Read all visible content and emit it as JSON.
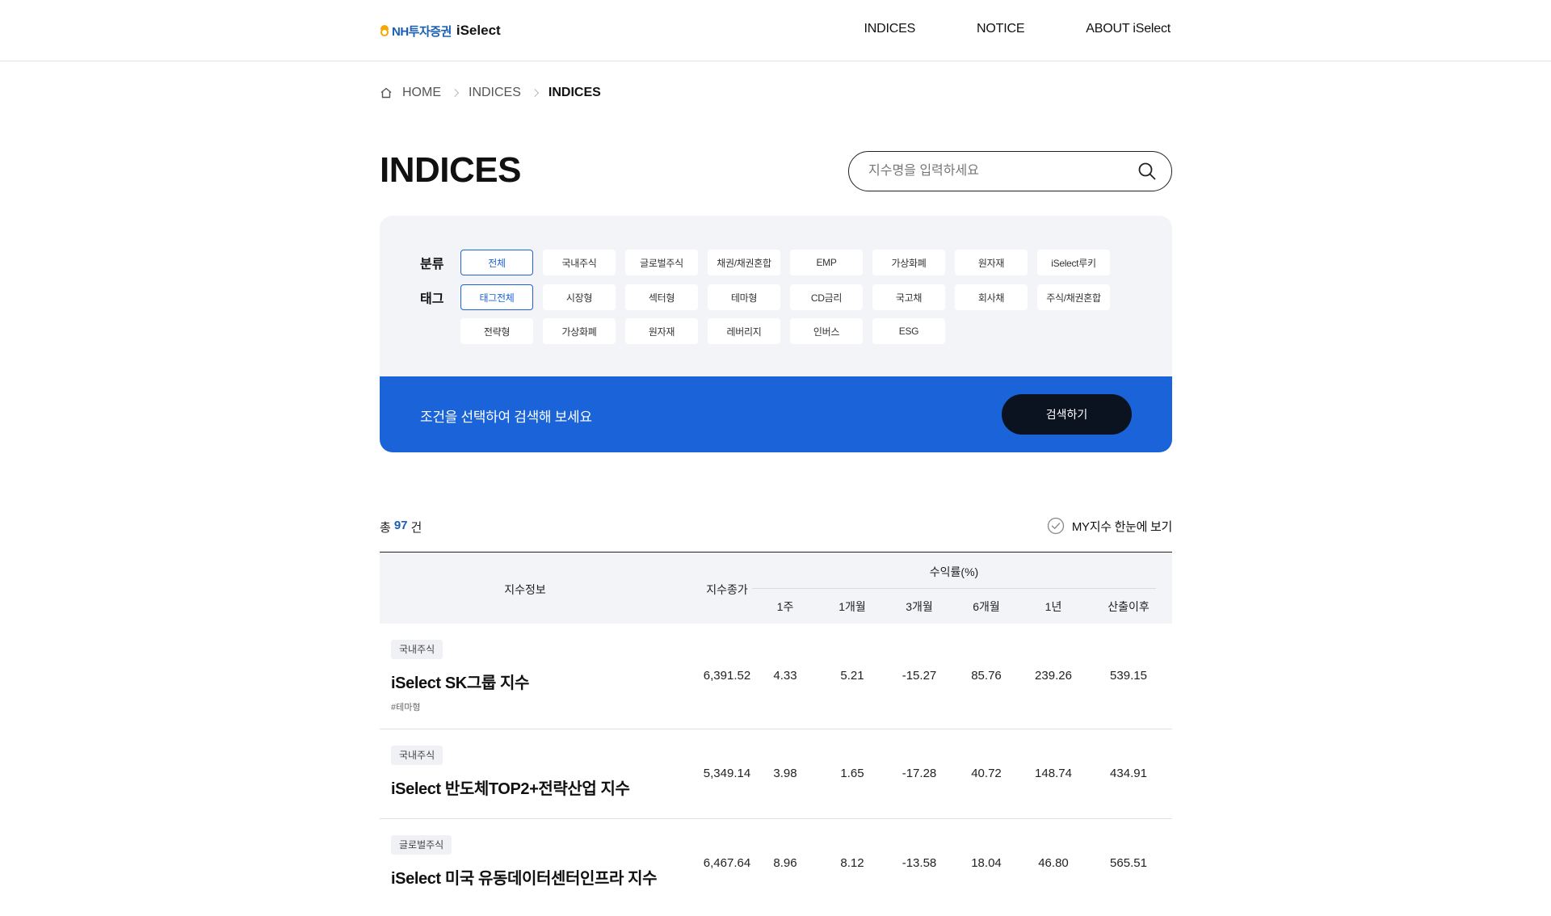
{
  "header": {
    "logo_brand": "NH투자증권",
    "logo_product": "iSelect",
    "nav": [
      "INDICES",
      "NOTICE",
      "ABOUT iSelect"
    ]
  },
  "breadcrumb": [
    "HOME",
    "INDICES",
    "INDICES"
  ],
  "page_title": "INDICES",
  "search": {
    "placeholder": "지수명을 입력하세요",
    "icon": "search-icon"
  },
  "filters": {
    "category_label": "분류",
    "categories": [
      "전체",
      "국내주식",
      "글로벌주식",
      "채권/채권혼합",
      "EMP",
      "가상화폐",
      "원자재",
      "iSelect루키"
    ],
    "category_selected": "전체",
    "tag_label": "태그",
    "tags_row1": [
      "태그전체",
      "시장형",
      "섹터형",
      "테마형",
      "CD금리",
      "국고채",
      "회사채",
      "주식/채권혼합"
    ],
    "tags_row2": [
      "전략형",
      "가상화폐",
      "원자재",
      "레버리지",
      "인버스",
      "ESG"
    ],
    "tag_selected": "태그전체"
  },
  "search_bar": {
    "prompt": "조건을 선택하여 검색해 보세요",
    "button": "검색하기"
  },
  "results": {
    "total_prefix": "총",
    "total_count": "97",
    "total_suffix": "건",
    "my_toggle": "MY지수 한눈에 보기"
  },
  "table": {
    "headers": {
      "info": "지수정보",
      "close": "지수종가",
      "returns_group": "수익률(%)",
      "periods": [
        "1주",
        "1개월",
        "3개월",
        "6개월",
        "1년",
        "산출이후"
      ]
    },
    "rows": [
      {
        "category": "국내주식",
        "name": "iSelect SK그룹 지수",
        "tag": "#테마형",
        "close": "6,391.52",
        "returns": [
          "4.33",
          "5.21",
          "-15.27",
          "85.76",
          "239.26",
          "539.15"
        ]
      },
      {
        "category": "국내주식",
        "name": "iSelect 반도체TOP2+전략산업 지수",
        "tag": "",
        "close": "5,349.14",
        "returns": [
          "3.98",
          "1.65",
          "-17.28",
          "40.72",
          "148.74",
          "434.91"
        ]
      },
      {
        "category": "글로벌주식",
        "name": "iSelect 미국 유동데이터센터인프라 지수",
        "tag": "",
        "close": "6,467.64",
        "returns": [
          "8.96",
          "8.12",
          "-13.58",
          "18.04",
          "46.80",
          "565.51"
        ]
      }
    ]
  },
  "colors": {
    "accent": "#1a63d8",
    "dark_button": "#0b1220",
    "panel_bg": "#f3f4f8",
    "brand": "#1a5fb4"
  }
}
